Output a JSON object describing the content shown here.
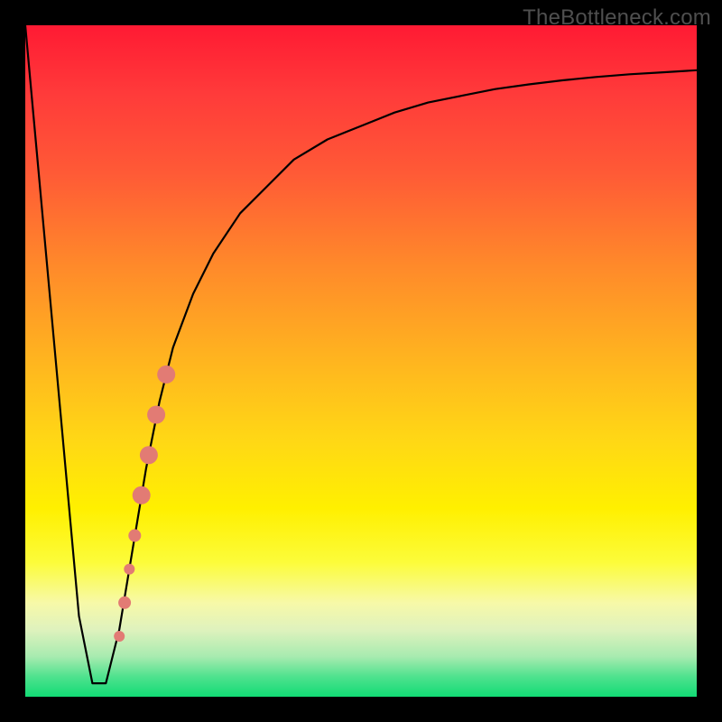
{
  "watermark": "TheBottleneck.com",
  "chart_data": {
    "type": "line",
    "title": "",
    "xlabel": "",
    "ylabel": "",
    "xlim": [
      0,
      100
    ],
    "ylim": [
      0,
      100
    ],
    "grid": false,
    "series": [
      {
        "name": "curve",
        "x": [
          0,
          8,
          10,
          12,
          14,
          16,
          18,
          20,
          22,
          25,
          28,
          32,
          36,
          40,
          45,
          50,
          55,
          60,
          65,
          70,
          75,
          80,
          85,
          90,
          95,
          100
        ],
        "y": [
          100,
          12,
          2,
          2,
          10,
          22,
          34,
          44,
          52,
          60,
          66,
          72,
          76,
          80,
          83,
          85,
          87,
          88.5,
          89.5,
          90.5,
          91.2,
          91.8,
          92.3,
          92.7,
          93.0,
          93.3
        ]
      }
    ],
    "markers": [
      {
        "name": "band-top",
        "x": 21.0,
        "y": 48,
        "r": 10
      },
      {
        "name": "band-mid1",
        "x": 19.5,
        "y": 42,
        "r": 10
      },
      {
        "name": "band-mid2",
        "x": 18.4,
        "y": 36,
        "r": 10
      },
      {
        "name": "band-bot",
        "x": 17.3,
        "y": 30,
        "r": 10
      },
      {
        "name": "dot-1",
        "x": 16.3,
        "y": 24,
        "r": 7
      },
      {
        "name": "dot-2",
        "x": 15.5,
        "y": 19,
        "r": 6
      },
      {
        "name": "dot-3",
        "x": 14.8,
        "y": 14,
        "r": 7
      },
      {
        "name": "dot-4",
        "x": 14.0,
        "y": 9,
        "r": 6
      }
    ],
    "marker_color": "#e27b74"
  }
}
